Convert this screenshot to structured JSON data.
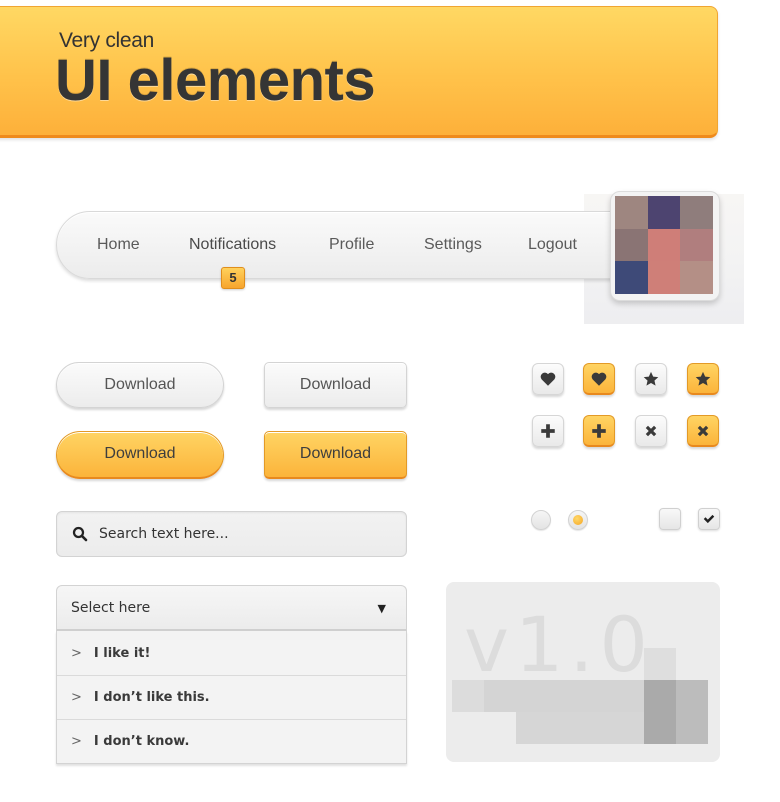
{
  "header": {
    "subtitle": "Very clean",
    "title": "UI elements",
    "accent_color": "#fbb43b"
  },
  "nav": {
    "items": [
      {
        "label": "Home"
      },
      {
        "label": "Notifications",
        "badge": "5"
      },
      {
        "label": "Profile"
      },
      {
        "label": "Settings"
      },
      {
        "label": "Logout"
      }
    ],
    "avatar": {
      "icon": "avatar-image-pixelated",
      "pixel_colors": [
        "#9e8680",
        "#4d4470",
        "#8f7d7c",
        "#8a7474",
        "#cf7e78",
        "#b07e7e",
        "#3e4a78",
        "#cf7f78",
        "#b48f86"
      ]
    }
  },
  "buttons": {
    "gray_pill": "Download",
    "gray_rect": "Download",
    "orange_pill": "Download",
    "orange_rect": "Download"
  },
  "icon_buttons": [
    {
      "icon": "heart-icon",
      "style": "gray"
    },
    {
      "icon": "heart-icon",
      "style": "orange"
    },
    {
      "icon": "star-icon",
      "style": "gray"
    },
    {
      "icon": "star-icon",
      "style": "orange"
    },
    {
      "icon": "plus-icon",
      "style": "gray"
    },
    {
      "icon": "plus-icon",
      "style": "orange"
    },
    {
      "icon": "close-icon",
      "style": "gray"
    },
    {
      "icon": "close-icon",
      "style": "orange"
    }
  ],
  "radios": [
    {
      "checked": false
    },
    {
      "checked": true
    }
  ],
  "checkboxes": [
    {
      "checked": false
    },
    {
      "checked": true
    }
  ],
  "search": {
    "placeholder": "Search text here...",
    "value": ""
  },
  "select": {
    "label": "Select here",
    "options": [
      {
        "label": "I like it!"
      },
      {
        "label": "I don’t like this."
      },
      {
        "label": "I don’t know."
      }
    ]
  },
  "version_card": {
    "version": "v1.0"
  }
}
